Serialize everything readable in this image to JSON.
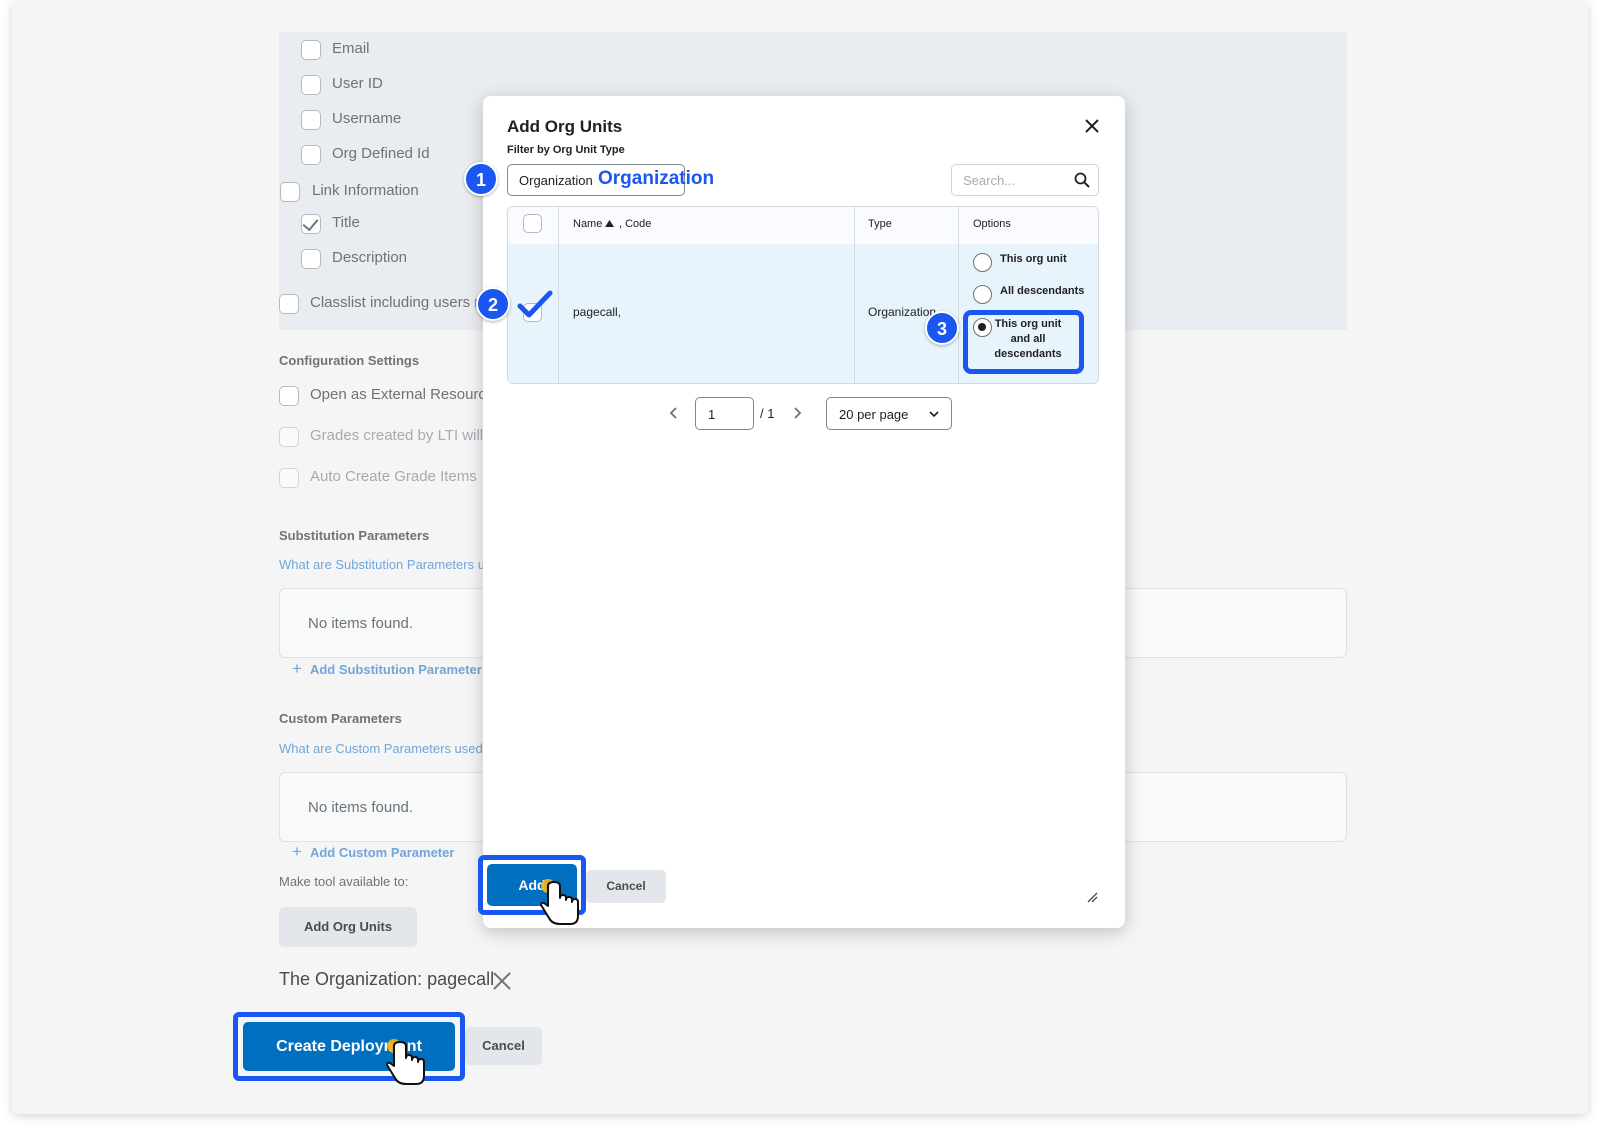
{
  "background": {
    "checkboxes": [
      {
        "label": "Email",
        "checked": false
      },
      {
        "label": "User ID",
        "checked": false
      },
      {
        "label": "Username",
        "checked": false
      },
      {
        "label": "Org Defined Id",
        "checked": false
      },
      {
        "label": "Link Information",
        "checked": false
      },
      {
        "label": "Title",
        "checked": true
      },
      {
        "label": "Description",
        "checked": false
      },
      {
        "label": "Classlist including users not",
        "checked": false
      }
    ],
    "config_heading": "Configuration Settings",
    "config_options": [
      {
        "label": "Open as External Resource"
      },
      {
        "label": "Grades created by LTI will be"
      },
      {
        "label": "Auto Create Grade Items"
      }
    ],
    "substitution": {
      "heading": "Substitution Parameters",
      "help_link": "What are Substitution Parameters use",
      "empty": "No items found.",
      "add_link": "Add Substitution Parameter"
    },
    "custom": {
      "heading": "Custom Parameters",
      "help_link": "What are Custom Parameters used fo",
      "empty": "No items found.",
      "add_link": "Add Custom Parameter"
    },
    "availability_label": "Make tool available to:",
    "add_org_units_button": "Add Org Units",
    "selected_org": "The Organization: pagecall",
    "create_button": "Create Deployment",
    "cancel_button": "Cancel"
  },
  "dialog": {
    "title": "Add Org Units",
    "close_icon": "close-icon",
    "filter_label": "Filter by Org Unit Type",
    "filter_value": "Organization",
    "filter_annotation": "Organization",
    "search_placeholder": "Search...",
    "columns": {
      "name": "Name",
      "code": ", Code",
      "type": "Type",
      "options": "Options"
    },
    "row": {
      "name": "pagecall,",
      "type": "Organization",
      "checked": true,
      "options": [
        "This org unit",
        "All descendants",
        "This org unit and all descendants"
      ],
      "selected_option": 2
    },
    "pager": {
      "page": "1",
      "total": "/ 1",
      "per_page": "20 per page"
    },
    "add_button": "Add",
    "cancel_button": "Cancel"
  },
  "steps": [
    "1",
    "2",
    "3"
  ],
  "accent_color": "#1a56f0",
  "primary_color": "#006fbf"
}
